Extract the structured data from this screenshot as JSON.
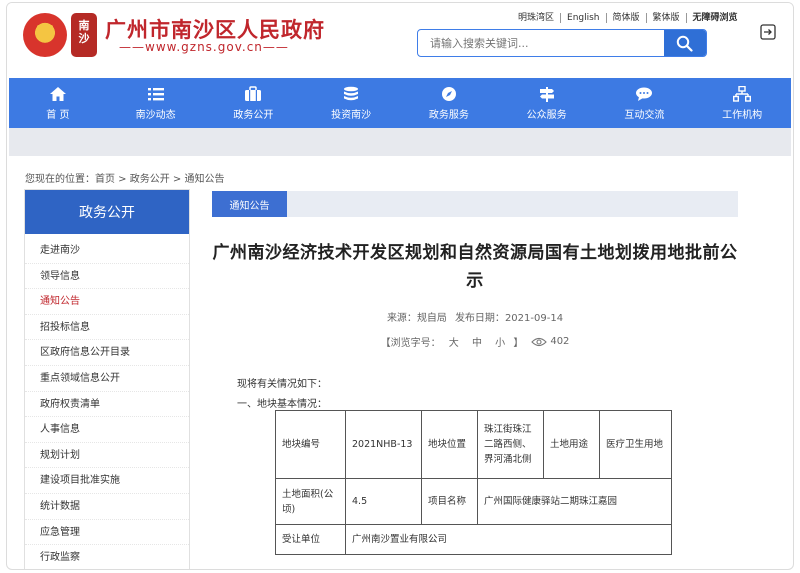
{
  "header": {
    "seal_text": "南沙",
    "site_title": "广州市南沙区人民政府",
    "site_url": "——www.gzns.gov.cn——",
    "top_links": [
      "明珠湾区",
      "English",
      "简体版",
      "繁体版",
      "无障碍浏览"
    ],
    "search_placeholder": "请输入搜索关键词..."
  },
  "nav": {
    "items": [
      {
        "label": "首 页",
        "icon": "home-icon"
      },
      {
        "label": "南沙动态",
        "icon": "list-icon"
      },
      {
        "label": "政务公开",
        "icon": "briefcase-icon"
      },
      {
        "label": "投资南沙",
        "icon": "coins-icon"
      },
      {
        "label": "政务服务",
        "icon": "compass-icon"
      },
      {
        "label": "公众服务",
        "icon": "signpost-icon"
      },
      {
        "label": "互动交流",
        "icon": "chat-icon"
      },
      {
        "label": "工作机构",
        "icon": "org-chart-icon"
      }
    ]
  },
  "breadcrumb": {
    "prefix": "您现在的位置：",
    "items": [
      "首页",
      "政务公开",
      "通知公告"
    ],
    "separator": " > "
  },
  "sidebar": {
    "title": "政务公开",
    "items": [
      "走进南沙",
      "领导信息",
      "通知公告",
      "招投标信息",
      "区政府信息公开目录",
      "重点领域信息公开",
      "政府权责清单",
      "人事信息",
      "规划计划",
      "建设项目批准实施",
      "统计数据",
      "应急管理",
      "行政监察"
    ],
    "active_index": 2
  },
  "main": {
    "tab_label": "通知公告",
    "title": "广州南沙经济技术开发区规划和自然资源局国有土地划拨用地批前公示",
    "source_label": "来源：",
    "source": "规自局",
    "date_label": "发布日期：",
    "date": "2021-09-14",
    "font_label": "【浏览字号：",
    "font_sizes": [
      "大",
      "中",
      "小"
    ],
    "font_close": "】",
    "views": "402",
    "intro": "现将有关情况如下：",
    "section1": "一、地块基本情况：",
    "table": {
      "r1": [
        "地块编号",
        "2021NHB-13",
        "地块位置",
        "珠江街珠江二路西侧、界河涌北侧",
        "土地用途",
        "医疗卫生用地"
      ],
      "r2": [
        "土地面积(公顷)",
        "4.5",
        "项目名称",
        "广州国际健康驿站二期珠江嘉园"
      ],
      "r3": [
        "受让单位",
        "广州南沙置业有限公司"
      ]
    }
  },
  "colors": {
    "brand_red": "#c0262c",
    "nav_blue": "#3d7ae3",
    "sidebar_blue": "#2f64c4"
  }
}
